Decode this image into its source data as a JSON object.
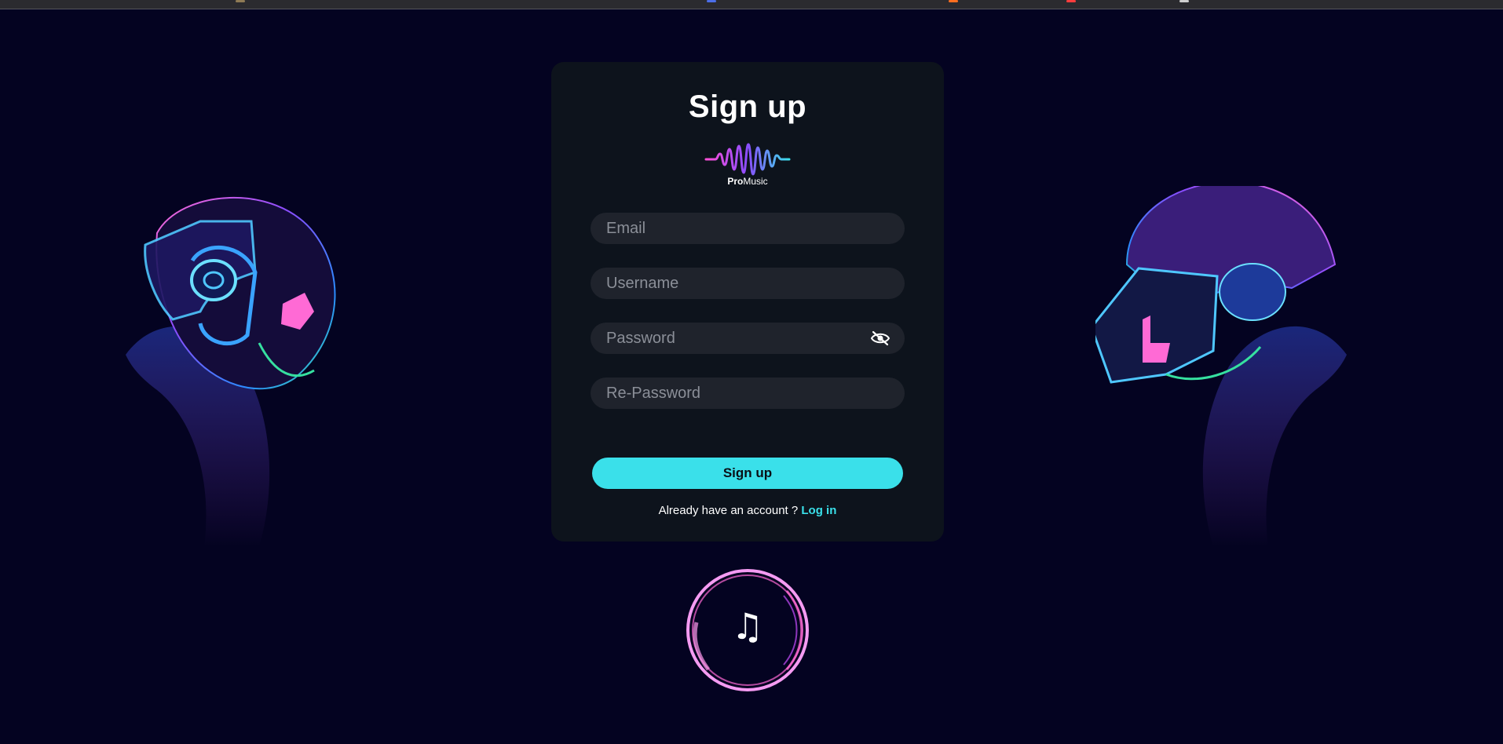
{
  "form": {
    "title": "Sign up",
    "logo": {
      "brand_bold": "Pro",
      "brand_rest": "Music",
      "icon": "soundwave-logo-icon"
    },
    "email_placeholder": "Email",
    "username_placeholder": "Username",
    "password_placeholder": "Password",
    "repassword_placeholder": "Re-Password",
    "password_toggle_icon": "eye-slash-icon",
    "submit_label": "Sign up",
    "footer_text": "Already have an account ? ",
    "login_link": "Log in"
  },
  "decor": {
    "left_illustration": "helmet-left-illustration",
    "right_illustration": "helmet-right-illustration",
    "music_icon": "music-note-icon",
    "music_glyph": "♫"
  },
  "colors": {
    "background": "#040321",
    "card": "#0d131c",
    "field": "#1f232c",
    "accent": "#3ae0ea",
    "pink": "#ff6ad5",
    "purple": "#8a4dff"
  }
}
